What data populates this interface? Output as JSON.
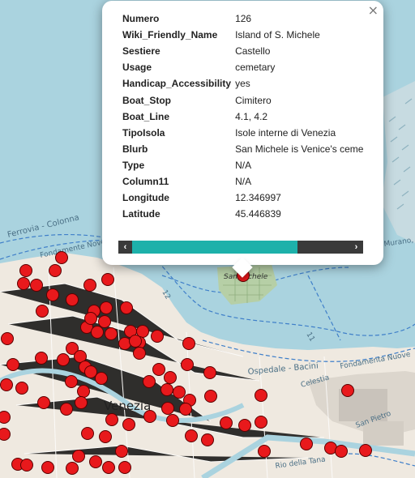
{
  "popup": {
    "close_label": "×",
    "rows": [
      {
        "key": "Numero",
        "value": "126"
      },
      {
        "key": "Wiki_Friendly_Name",
        "value": "Island of S. Michele"
      },
      {
        "key": "Sestiere",
        "value": "Castello"
      },
      {
        "key": "Usage",
        "value": "cemetary"
      },
      {
        "key": "Handicap_Accessibility",
        "value": "yes"
      },
      {
        "key": "Boat_Stop",
        "value": "Cimitero"
      },
      {
        "key": "Boat_Line",
        "value": "4.1, 4.2"
      },
      {
        "key": "TipoIsola",
        "value": "Isole interne di Venezia"
      },
      {
        "key": "Blurb",
        "value": "San Michele is Venice's cemetary"
      },
      {
        "key": "Type",
        "value": "N/A"
      },
      {
        "key": "Column11",
        "value": "N/A"
      },
      {
        "key": "Longitude",
        "value": "12.346997"
      },
      {
        "key": "Latitude",
        "value": "45.446839"
      }
    ],
    "scroll_left": "‹",
    "scroll_right": "›"
  },
  "map_labels": {
    "city": "Venezia",
    "island": "San Michele",
    "ferrovia": "Ferrovia - Colonna",
    "fondamente_left": "Fondamente Nove",
    "ospedale": "Ospedale - Bacini",
    "celestia": "Celestia",
    "fondamenta_nuove": "Fondamenta Nuove",
    "rio_tana": "Rio della Tana",
    "san_pietro": "San Pietro",
    "murano": "Murano, Colonna",
    "line_12": "12",
    "line_11": "11"
  },
  "colors": {
    "water": "#aad3df",
    "land": "#efe9e0",
    "marker_fill": "#e8191c",
    "popup_scroll_thumb": "#1db1aa"
  },
  "markers_note": "point markers of Venice islands/locations"
}
